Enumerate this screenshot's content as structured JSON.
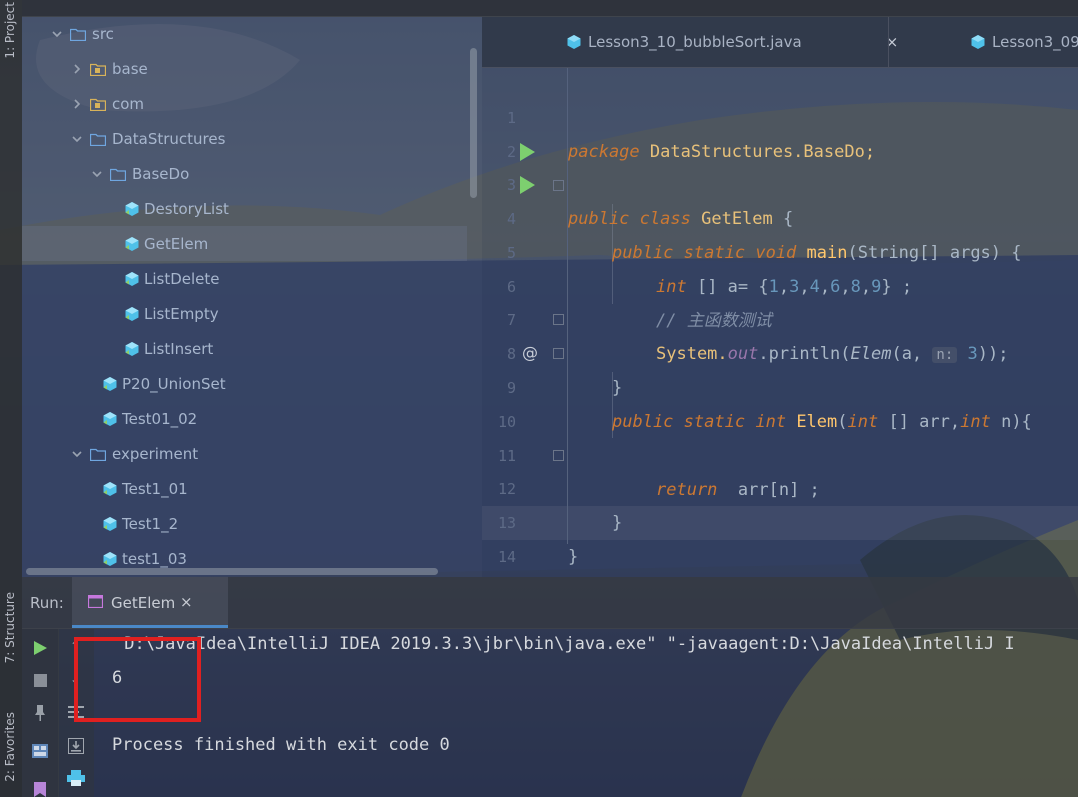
{
  "left_strip": {
    "project_label": "1: Project",
    "structure_label": "7: Structure",
    "favorites_label": "2: Favorites"
  },
  "project_tree": [
    {
      "label": "src",
      "type": "src-folder",
      "depth": 0,
      "expanded": true
    },
    {
      "label": "base",
      "type": "package",
      "depth": 1,
      "expanded": false
    },
    {
      "label": "com",
      "type": "package",
      "depth": 1,
      "expanded": false
    },
    {
      "label": "DataStructures",
      "type": "folder",
      "depth": 1,
      "expanded": true
    },
    {
      "label": "BaseDo",
      "type": "folder",
      "depth": 2,
      "expanded": true
    },
    {
      "label": "DestoryList",
      "type": "class",
      "depth": 3
    },
    {
      "label": "GetElem",
      "type": "class",
      "depth": 3,
      "selected": true
    },
    {
      "label": "ListDelete",
      "type": "class",
      "depth": 3
    },
    {
      "label": "ListEmpty",
      "type": "class",
      "depth": 3
    },
    {
      "label": "ListInsert",
      "type": "class",
      "depth": 3
    },
    {
      "label": "P20_UnionSet",
      "type": "class",
      "depth": 2
    },
    {
      "label": "Test01_02",
      "type": "class",
      "depth": 2
    },
    {
      "label": "experiment",
      "type": "folder",
      "depth": 1,
      "expanded": true
    },
    {
      "label": "Test1_01",
      "type": "class",
      "depth": 2
    },
    {
      "label": "Test1_2",
      "type": "class",
      "depth": 2
    },
    {
      "label": "test1_03",
      "type": "class",
      "depth": 2
    }
  ],
  "editor": {
    "tabs": [
      {
        "label": "Lesson3_10_bubbleSort.java",
        "close": "×"
      },
      {
        "label": "Lesson3_09"
      }
    ],
    "line_numbers": [
      "1",
      "2",
      "3",
      "4",
      "5",
      "6",
      "7",
      "8",
      "9",
      "10",
      "11",
      "12",
      "13",
      "14"
    ],
    "code": {
      "l1_kw": "package",
      "l1_rest": " DataStructures.BaseDo;",
      "l3_kw1": "public",
      "l3_kw2": "class",
      "l3_name": "GetElem",
      "l3_rest": " {",
      "l4_kw1": "public",
      "l4_kw2": "static",
      "l4_kw3": "void",
      "l4_fn": "main",
      "l4_rest": "(String[] args) {",
      "l5_kw": "int",
      "l5_rest_a": " [] a= {",
      "l5_nums": [
        "1",
        "3",
        "4",
        "6",
        "8",
        "9"
      ],
      "l5_rest_b": "} ;",
      "l6_comment": "// 主函数测试",
      "l7_sys": "System.",
      "l7_out": "out",
      "l7_call": ".println(",
      "l7_elem": "Elem",
      "l7_arg": "(a, ",
      "l7_hint": "n:",
      "l7_num": "3",
      "l7_end": "));",
      "l8_brace": "}",
      "l9_kw1": "public",
      "l9_kw2": "static",
      "l9_kw3": "int",
      "l9_fn": "Elem",
      "l9_p1": "(",
      "l9_kw4": "int",
      "l9_p2": " [] arr,",
      "l9_kw5": "int",
      "l9_p3": " n){",
      "l9_marker": "@",
      "l11_kw": "return",
      "l11_rest": "  arr[n] ;",
      "l12_brace": "}",
      "l13_brace": "}"
    }
  },
  "run_panel": {
    "label": "Run:",
    "tab_label": "GetElem",
    "tab_close": "×",
    "output": [
      " D:\\JavaIdea\\IntelliJ IDEA 2019.3.3\\jbr\\bin\\java.exe\" \"-javaagent:D:\\JavaIdea\\IntelliJ I",
      "6",
      "",
      "Process finished with exit code 0"
    ]
  },
  "colors": {
    "keyword": "#cc7832",
    "number": "#6897bb",
    "run_green": "#7dcf6f",
    "highlight_red": "#e02020",
    "java_icon": "#4fc1e9"
  }
}
